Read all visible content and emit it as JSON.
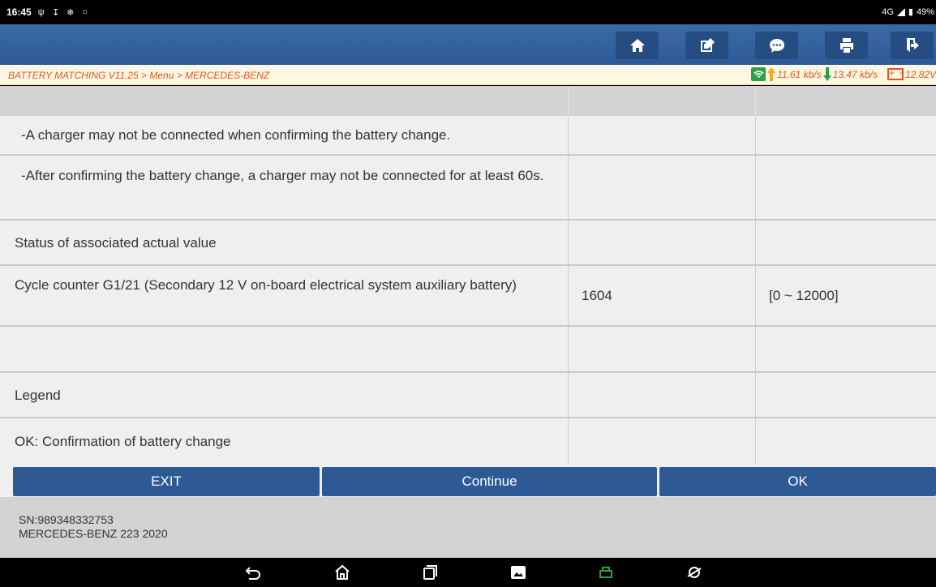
{
  "status_bar": {
    "time": "16:45",
    "network": "4G",
    "battery": "49%"
  },
  "toolbar": {
    "buttons": [
      "home-icon",
      "edit-report-icon",
      "feedback-icon",
      "print-icon",
      "exit-app-icon"
    ]
  },
  "breadcrumb": "BATTERY MATCHING V11.25 > Menu > MERCEDES-BENZ",
  "net_info": {
    "upload": "11.61 kb/s",
    "download": "13.47 kb/s",
    "voltage": "12.82V"
  },
  "table": {
    "rows": [
      {
        "name": "",
        "value": "",
        "range": ""
      },
      {
        "name": "-A charger may not be connected when confirming the battery change.",
        "value": "",
        "range": ""
      },
      {
        "name": "-After confirming the battery change, a charger may not be connected for at least 60s.",
        "value": "",
        "range": ""
      },
      {
        "name": "Status of associated actual value",
        "value": "",
        "range": ""
      },
      {
        "name": "Cycle counter G1/21 (Secondary 12 V on-board electrical system auxiliary battery)",
        "value": "1604",
        "range": "[0 ~ 12000]"
      },
      {
        "name": "",
        "value": "",
        "range": ""
      },
      {
        "name": "Legend",
        "value": "",
        "range": ""
      },
      {
        "name": "OK: Confirmation of battery change",
        "value": "",
        "range": ""
      }
    ]
  },
  "buttons": {
    "exit": "EXIT",
    "continue": "Continue",
    "ok": "OK"
  },
  "footer": {
    "sn": "SN:989348332753",
    "vehicle": "MERCEDES-BENZ 223 2020"
  },
  "colors": {
    "toolbar": "#2d5a95",
    "breadcrumb_text": "#e8531f",
    "wifi": "#2ea043",
    "upload_arrow": "#f5a623",
    "download_arrow": "#2ea043"
  }
}
